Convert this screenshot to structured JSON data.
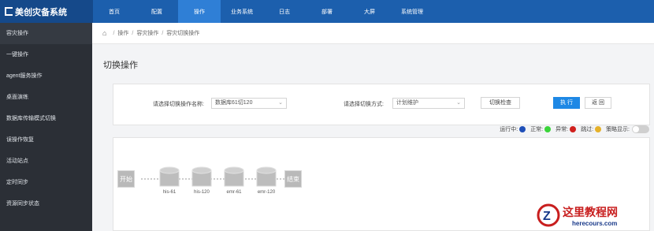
{
  "brand": {
    "name": "美创灾备系统"
  },
  "nav": [
    {
      "label": "首页"
    },
    {
      "label": "配置"
    },
    {
      "label": "操作"
    },
    {
      "label": "业务系统"
    },
    {
      "label": "日志"
    },
    {
      "label": "部署"
    },
    {
      "label": "大屏"
    },
    {
      "label": "系统管理"
    }
  ],
  "nav_active": "操作",
  "sidebar": {
    "items": [
      {
        "label": "容灾操作"
      },
      {
        "label": "一键操作"
      },
      {
        "label": "agent服务操作"
      },
      {
        "label": "桌面演练"
      },
      {
        "label": "数据库传输模式切换"
      },
      {
        "label": "误操作恢复"
      },
      {
        "label": "活动站点"
      },
      {
        "label": "定时同步"
      },
      {
        "label": "资源同步状态"
      }
    ]
  },
  "breadcrumb": {
    "items": [
      "操作",
      "容灾操作",
      "容灾切换操作"
    ]
  },
  "page": {
    "title": "切换操作"
  },
  "form": {
    "name_label": "请选择切换操作名称:",
    "name_value": "数据库61切120",
    "mode_label": "请选择切换方式:",
    "mode_value": "计划维护",
    "check_button": "切换检查",
    "execute_button": "执 行",
    "back_button": "返 回"
  },
  "legend": {
    "running": "运行中:",
    "normal": "正常:",
    "error": "异常:",
    "skip": "跳过:",
    "strategy": "策略显示:",
    "colors": {
      "running": "#1f4fb8",
      "normal": "#3ad43a",
      "error": "#d0201d",
      "skip": "#e5b12a"
    }
  },
  "flow": {
    "start": "开始",
    "end": "结束",
    "nodes": [
      "his-61",
      "his-120",
      "emr-61",
      "emr-120"
    ]
  },
  "watermark": {
    "title": "这里教程网",
    "url": "herecours.com"
  }
}
